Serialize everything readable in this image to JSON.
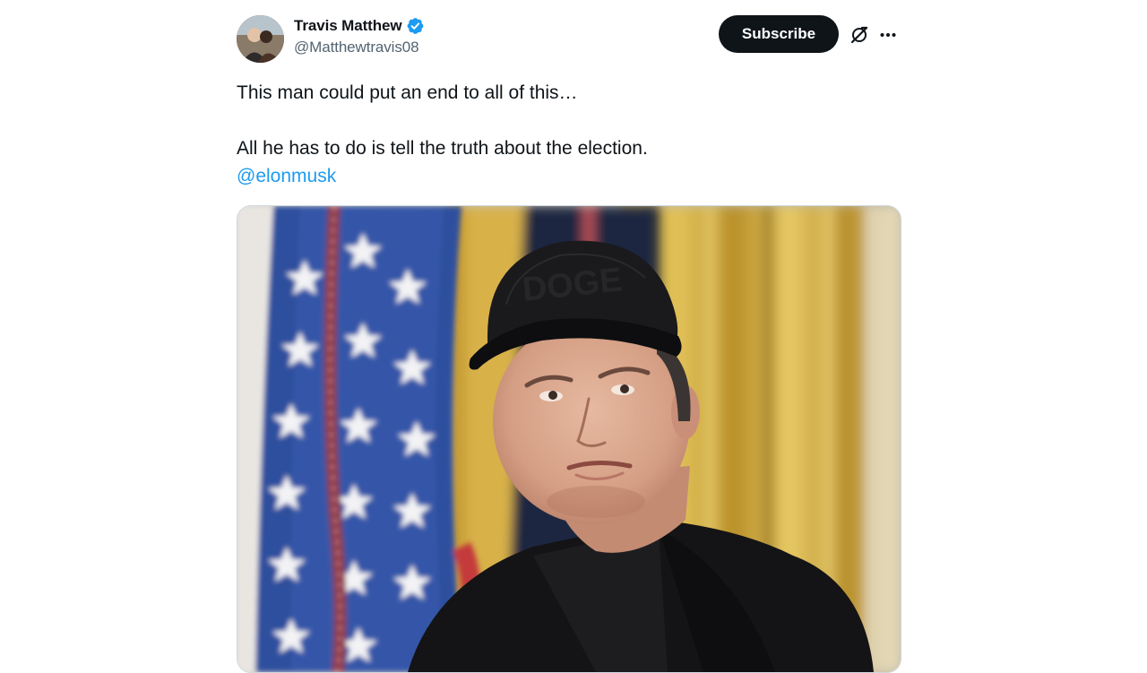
{
  "author": {
    "display_name": "Travis Matthew",
    "handle": "@Matthewtravis08",
    "verified": true,
    "avatar_icon": "avatar-photo"
  },
  "actions": {
    "subscribe_label": "Subscribe",
    "grok_icon": "grok-icon",
    "more_icon": "more-horizontal-icon"
  },
  "tweet": {
    "line1": "This man could put an end to all of this…",
    "line2": "All he has to do is tell the truth about the election.",
    "mention": "@elonmusk"
  },
  "media": {
    "cap_text": "DOGE"
  },
  "colors": {
    "accent": "#1d9bf0",
    "text_primary": "#0f1419",
    "text_secondary": "#536471",
    "button_bg": "#0f1419"
  }
}
